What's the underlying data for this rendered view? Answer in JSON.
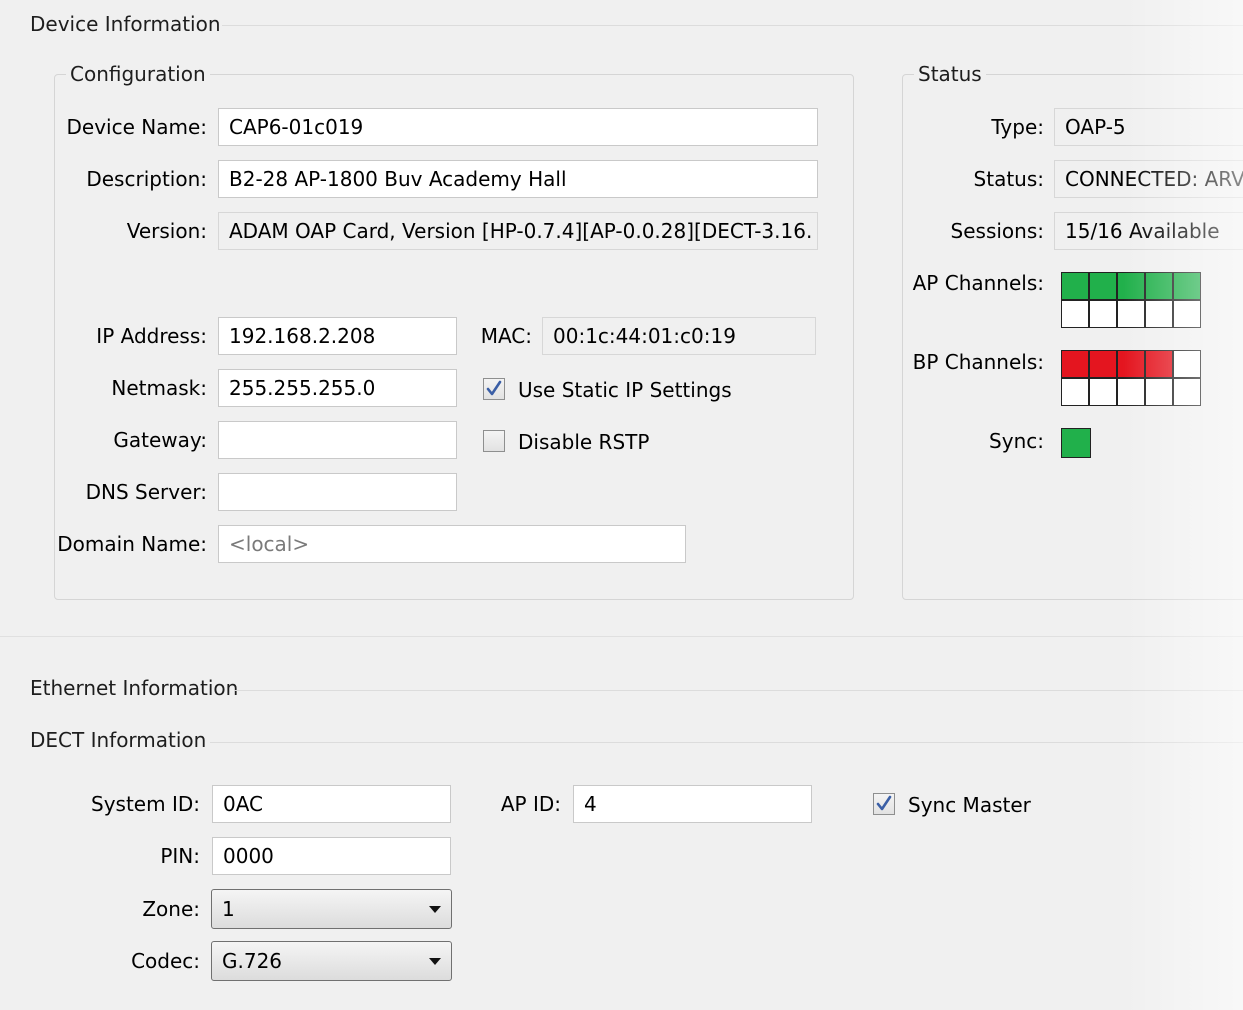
{
  "device_information": {
    "title": "Device Information",
    "configuration": {
      "title": "Configuration",
      "device_name": {
        "label": "Device Name:",
        "value": "CAP6-01c019"
      },
      "description": {
        "label": "Description:",
        "value": "B2-28 AP-1800 Buv Academy Hall"
      },
      "version": {
        "label": "Version:",
        "value": "ADAM OAP Card, Version [HP-0.7.4][AP-0.0.28][DECT-3.16."
      },
      "ip_address": {
        "label": "IP Address:",
        "value": "192.168.2.208"
      },
      "mac": {
        "label": "MAC:",
        "value": "00:1c:44:01:c0:19"
      },
      "netmask": {
        "label": "Netmask:",
        "value": "255.255.255.0"
      },
      "use_static_ip": {
        "label": "Use Static IP Settings",
        "checked": true
      },
      "gateway": {
        "label": "Gateway:",
        "value": ""
      },
      "disable_rstp": {
        "label": "Disable RSTP",
        "checked": false
      },
      "dns_server": {
        "label": "DNS Server:",
        "value": ""
      },
      "domain_name": {
        "label": "Domain Name:",
        "placeholder": "<local>"
      }
    },
    "status": {
      "title": "Status",
      "type": {
        "label": "Type:",
        "value": "OAP-5"
      },
      "status": {
        "label": "Status:",
        "value": "CONNECTED: ARV"
      },
      "sessions": {
        "label": "Sessions:",
        "value": "15/16 Available"
      },
      "ap_channels": {
        "label": "AP Channels:",
        "top_row": [
          "green",
          "green",
          "green",
          "green",
          "green"
        ],
        "bottom_row": [
          "empty",
          "empty",
          "empty",
          "empty",
          "empty"
        ]
      },
      "bp_channels": {
        "label": "BP Channels:",
        "top_row": [
          "red",
          "red",
          "red",
          "red",
          "empty"
        ],
        "bottom_row": [
          "empty",
          "empty",
          "empty",
          "empty",
          "empty"
        ]
      },
      "sync": {
        "label": "Sync:",
        "state": "green"
      }
    }
  },
  "ethernet_information": {
    "title": "Ethernet Information"
  },
  "dect_information": {
    "title": "DECT Information",
    "system_id": {
      "label": "System ID:",
      "value": "0AC"
    },
    "ap_id": {
      "label": "AP ID:",
      "value": "4"
    },
    "sync_master": {
      "label": "Sync Master",
      "checked": true
    },
    "pin": {
      "label": "PIN:",
      "value": "0000"
    },
    "zone": {
      "label": "Zone:",
      "value": "1"
    },
    "codec": {
      "label": "Codec:",
      "value": "G.726"
    }
  },
  "colors": {
    "green": "#21b04b",
    "red": "#e4151f",
    "empty": "#ffffff",
    "check": "#3b5fa6"
  }
}
